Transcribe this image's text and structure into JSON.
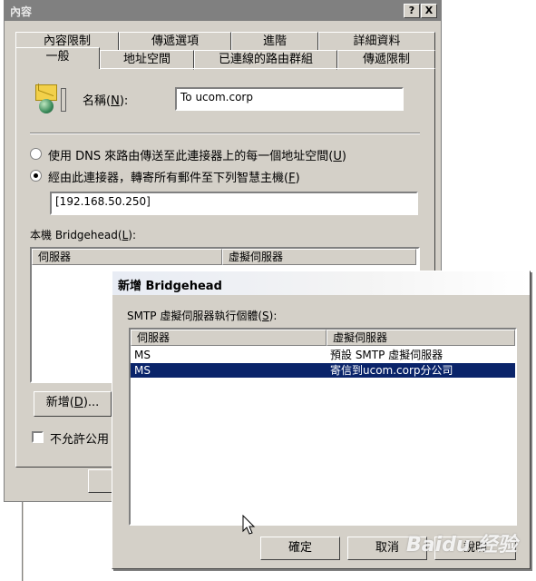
{
  "main_dialog": {
    "title": "內容",
    "help_btn": "?",
    "close_btn": "X",
    "tabs_back": [
      "內容限制",
      "傳遞選項",
      "進階",
      "詳細資料"
    ],
    "tabs_front": [
      "一般",
      "地址空間",
      "已連線的路由群組",
      "傳遞限制"
    ],
    "name_label": "名稱",
    "name_accel": "N",
    "name_value": "To ucom.corp",
    "radio1_label": "使用 DNS 來路由傳送至此連接器上的每一個地址空間",
    "radio1_accel": "U",
    "radio2_label": "經由此連接器，轉寄所有郵件至下列智慧主機",
    "radio2_accel": "F",
    "smarthost_value": "[192.168.50.250]",
    "bridgehead_label": "本機 Bridgehead",
    "bridgehead_accel": "L",
    "list_columns": [
      "伺服器",
      "虛擬伺服器"
    ],
    "add_button": "新增",
    "add_accel": "D",
    "checkbox_label": "不允許公用"
  },
  "add_dialog": {
    "title": "新增 Bridgehead",
    "instances_label": "SMTP 虛擬伺服器執行個體",
    "instances_accel": "S",
    "columns": [
      "伺服器",
      "虛擬伺服器"
    ],
    "rows": [
      {
        "server": "MS",
        "virtual": "預設 SMTP 虛擬伺服器",
        "selected": false
      },
      {
        "server": "MS",
        "virtual": "寄信到ucom.corp分公司",
        "selected": true
      }
    ],
    "ok_button": "確定",
    "cancel_button": "取消",
    "help_button": "說明"
  },
  "watermark": "Baidu 经验",
  "colors": {
    "face": "#d4d0c8",
    "selection": "#0a246a",
    "inactive_title": "#808080"
  }
}
